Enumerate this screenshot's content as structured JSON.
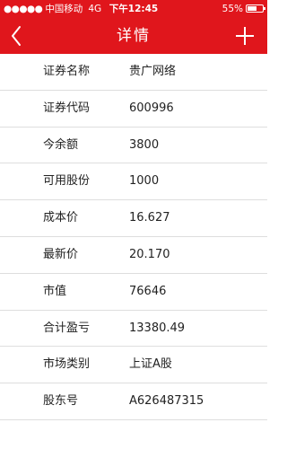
{
  "status_bar": {
    "signal_dots": "●●●●●",
    "carrier": "中国移动",
    "network": "4G",
    "time": "下午12:45",
    "battery_percent": "55%",
    "battery_level": 0.55
  },
  "nav": {
    "back_icon": "chevron-left-icon",
    "title": "详情",
    "add_icon": "plus-icon"
  },
  "colors": {
    "header_bg": "#e0161c",
    "header_text": "#ffffff",
    "divider": "#dedede"
  },
  "details": [
    {
      "label": "证券名称",
      "value": "贵广网络"
    },
    {
      "label": "证券代码",
      "value": "600996"
    },
    {
      "label": "今余额",
      "value": "3800"
    },
    {
      "label": "可用股份",
      "value": "1000"
    },
    {
      "label": "成本价",
      "value": "16.627"
    },
    {
      "label": "最新价",
      "value": "20.170"
    },
    {
      "label": "市值",
      "value": "76646"
    },
    {
      "label": "合计盈亏",
      "value": "13380.49"
    },
    {
      "label": "市场类别",
      "value": "上证A股"
    },
    {
      "label": "股东号",
      "value": "A626487315"
    }
  ]
}
